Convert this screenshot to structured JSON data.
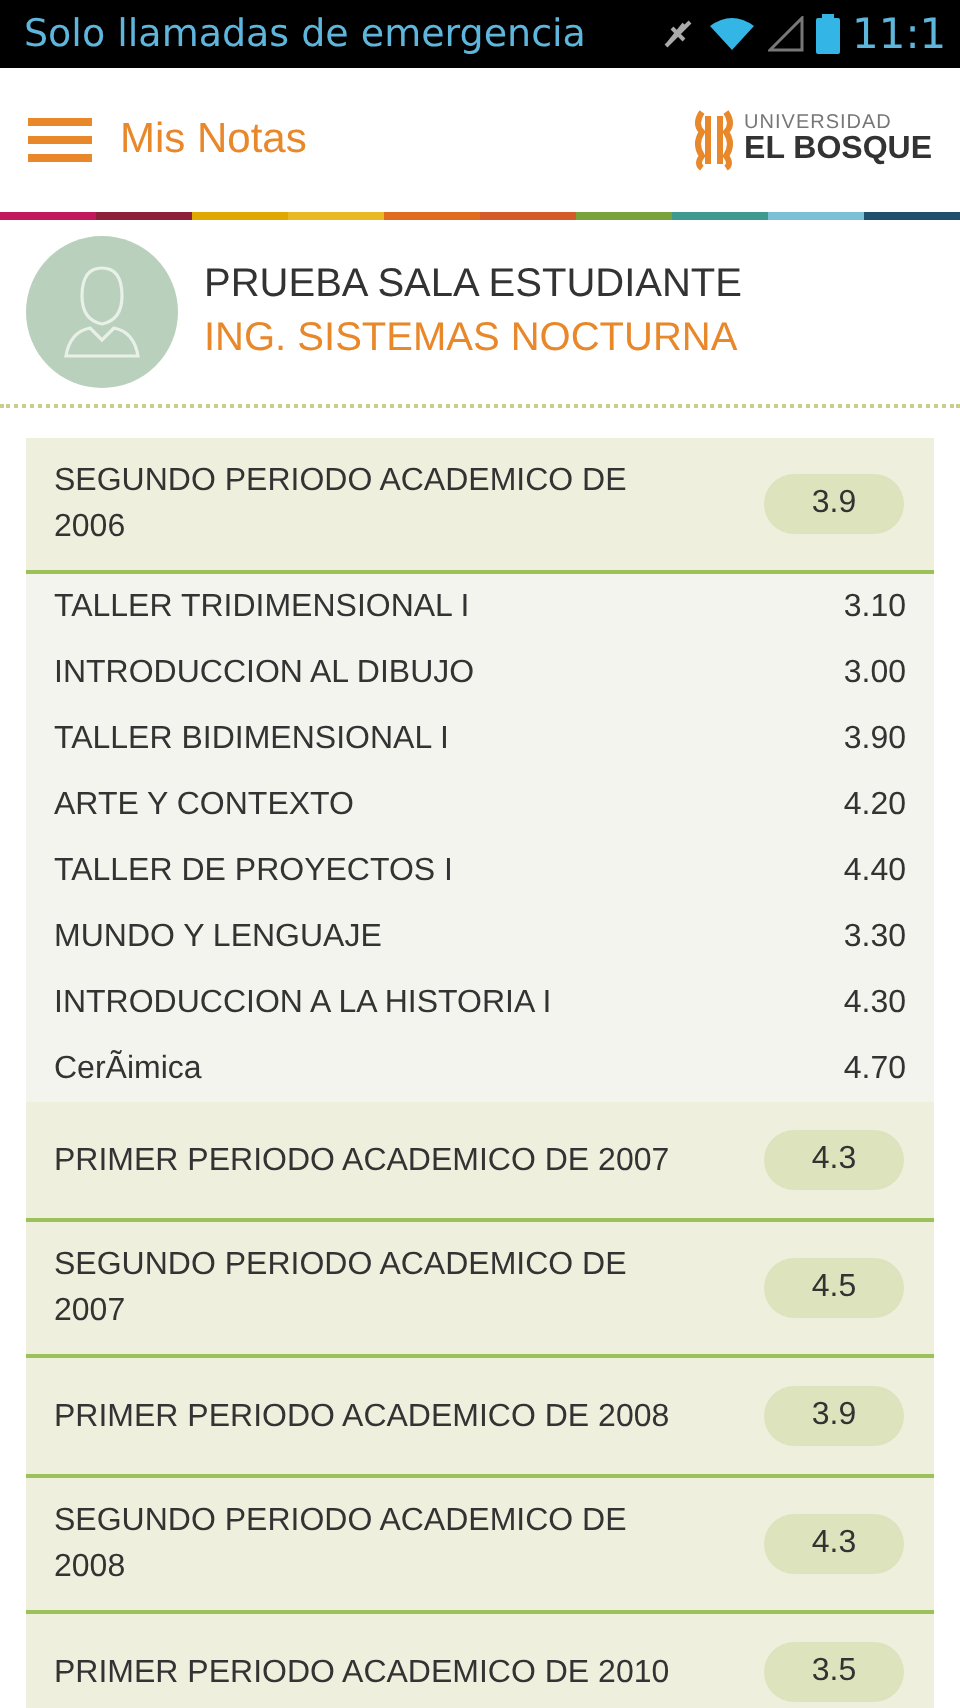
{
  "status_bar": {
    "carrier": "Solo llamadas de emergencia",
    "time": "11:1"
  },
  "header": {
    "title": "Mis Notas",
    "logo_top": "UNIVERSIDAD",
    "logo_bottom": "EL BOSQUE"
  },
  "profile": {
    "name": "PRUEBA SALA ESTUDIANTE",
    "program": "ING. SISTEMAS NOCTURNA"
  },
  "periods": [
    {
      "title": "SEGUNDO PERIODO ACADEMICO DE 2006",
      "average": "3.9",
      "courses": [
        {
          "name": "TALLER  TRIDIMENSIONAL I",
          "grade": "3.10"
        },
        {
          "name": "INTRODUCCION AL DIBUJO",
          "grade": "3.00"
        },
        {
          "name": "TALLER BIDIMENSIONAL I",
          "grade": "3.90"
        },
        {
          "name": "ARTE Y CONTEXTO",
          "grade": "4.20"
        },
        {
          "name": "TALLER DE PROYECTOS I",
          "grade": "4.40"
        },
        {
          "name": "MUNDO Y LENGUAJE",
          "grade": "3.30"
        },
        {
          "name": "INTRODUCCION A LA HISTORIA I",
          "grade": "4.30"
        },
        {
          "name": "CerÃimica",
          "grade": "4.70"
        }
      ]
    },
    {
      "title": "PRIMER PERIODO ACADEMICO DE 2007",
      "average": "4.3"
    },
    {
      "title": "SEGUNDO PERIODO ACADEMICO DE 2007",
      "average": "4.5"
    },
    {
      "title": "PRIMER PERIODO ACADEMICO DE 2008",
      "average": "3.9"
    },
    {
      "title": "SEGUNDO PERIODO ACADEMICO DE 2008",
      "average": "4.3"
    },
    {
      "title": "PRIMER PERIODO ACADEMICO DE 2010",
      "average": "3.5"
    }
  ]
}
